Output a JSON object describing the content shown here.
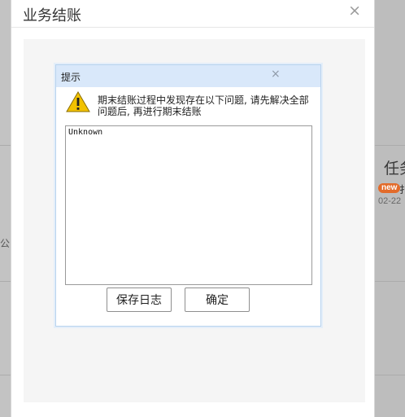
{
  "background": {
    "right_title": "任务",
    "badge": "new",
    "badge_text": "扌",
    "date": "02-22",
    "left_text": "公"
  },
  "modal": {
    "title": "业务结账",
    "close_icon": "close-icon"
  },
  "dialog": {
    "title": "提示",
    "close_glyph": "×",
    "warning_icon": "warning-triangle-icon",
    "message": "期末结账过程中发现存在以下问题, 请先解决全部问题后, 再进行期末结账",
    "log_text": "Unknown",
    "save_log_label": "保存日志",
    "ok_label": "确定"
  },
  "colors": {
    "dialog_header": "#d9e8fa",
    "dialog_border": "#b8d3ee",
    "warning_yellow": "#f2c200",
    "badge": "#e36b2a"
  }
}
